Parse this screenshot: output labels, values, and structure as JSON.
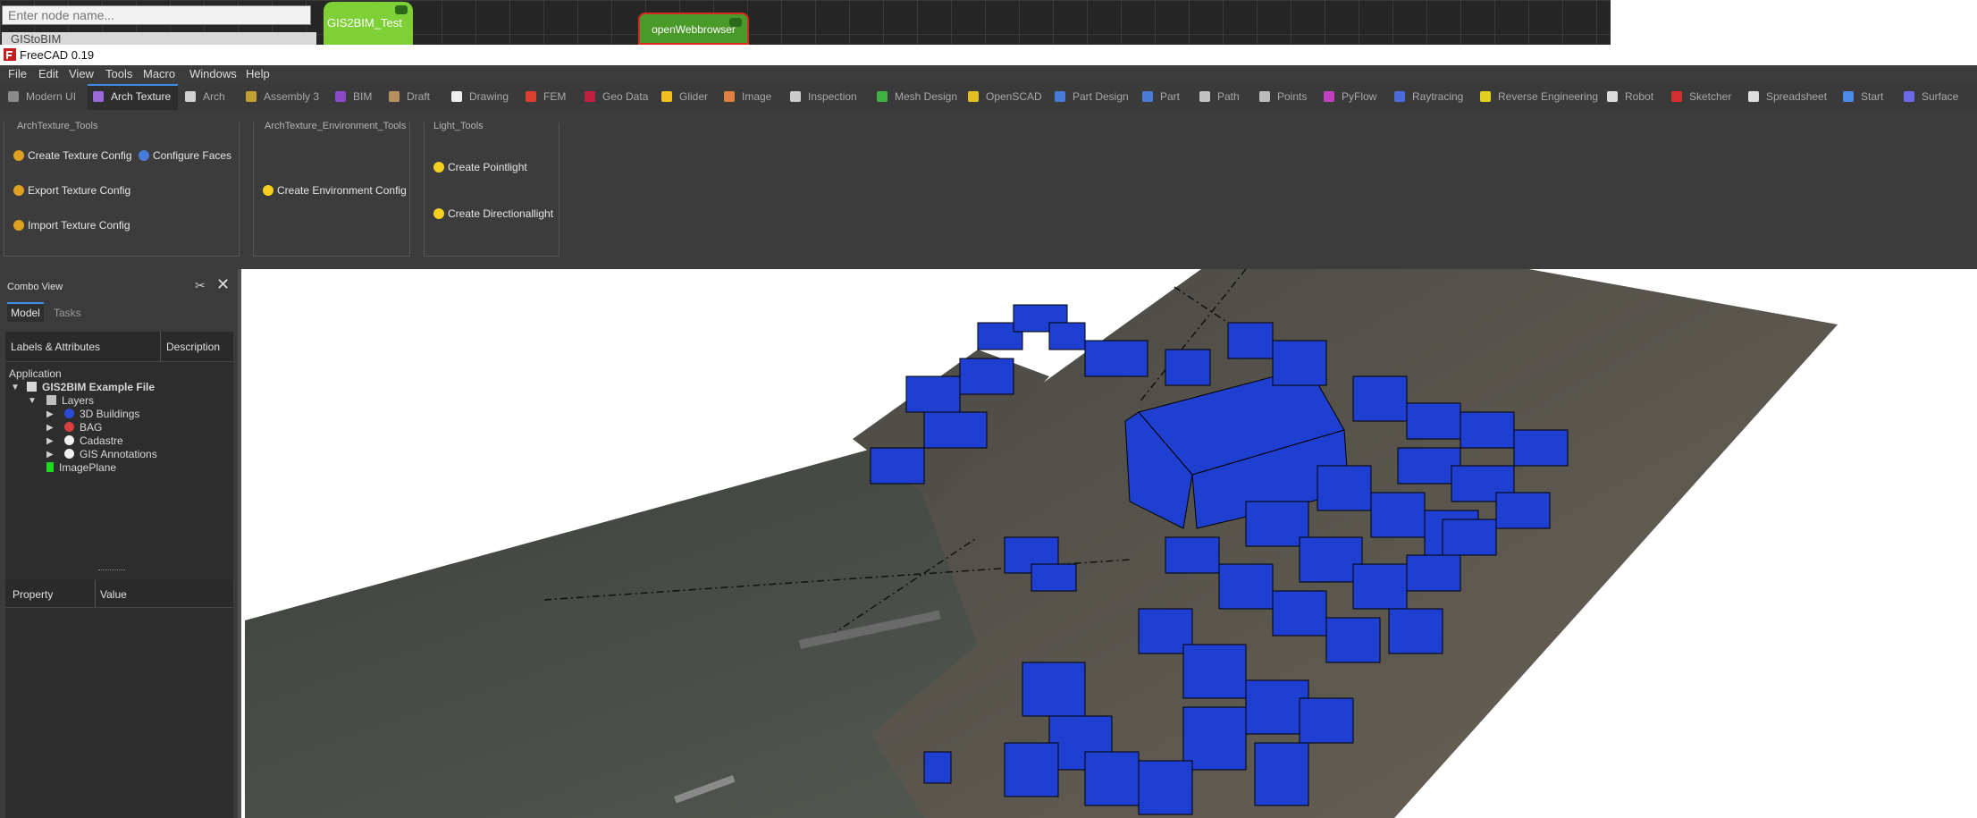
{
  "node_editor": {
    "search_placeholder": "Enter node name...",
    "list_item": "GIStoBIM",
    "node_gis2bim": "GIS2BIM_Test",
    "node_browser": "openWebbrowser"
  },
  "window": {
    "title": "FreeCAD 0.19"
  },
  "menu": [
    "File",
    "Edit",
    "View",
    "Tools",
    "Macro",
    "Windows",
    "Help"
  ],
  "workbenches": [
    {
      "label": "Modern UI",
      "color": "#8a8a8a"
    },
    {
      "label": "Arch Texture",
      "color": "#9a6ad8",
      "active": true
    },
    {
      "label": "Arch",
      "color": "#d0d0d0"
    },
    {
      "label": "Assembly 3",
      "color": "#c0a030"
    },
    {
      "label": "BIM",
      "color": "#8a4ac8"
    },
    {
      "label": "Draft",
      "color": "#b89060"
    },
    {
      "label": "Drawing",
      "color": "#eeeeee"
    },
    {
      "label": "FEM",
      "color": "#d84030"
    },
    {
      "label": "Geo Data",
      "color": "#c02040"
    },
    {
      "label": "Glider",
      "color": "#f0c020"
    },
    {
      "label": "Image",
      "color": "#e08040"
    },
    {
      "label": "Inspection",
      "color": "#cccccc"
    },
    {
      "label": "Mesh Design",
      "color": "#40b040"
    },
    {
      "label": "OpenSCAD",
      "color": "#e0c020"
    },
    {
      "label": "Part Design",
      "color": "#4a7ad8"
    },
    {
      "label": "Part",
      "color": "#4a7ad8"
    },
    {
      "label": "Path",
      "color": "#c0c0c0"
    },
    {
      "label": "Points",
      "color": "#bbbbbb"
    },
    {
      "label": "PyFlow",
      "color": "#c040c0"
    },
    {
      "label": "Raytracing",
      "color": "#4a6ad8"
    },
    {
      "label": "Reverse Engineering",
      "color": "#e0d020"
    },
    {
      "label": "Robot",
      "color": "#dddddd"
    },
    {
      "label": "Sketcher",
      "color": "#d03030"
    },
    {
      "label": "Spreadsheet",
      "color": "#dddddd"
    },
    {
      "label": "Start",
      "color": "#4a8ae8"
    },
    {
      "label": "Surface",
      "color": "#6a6ae8"
    }
  ],
  "ribbon": {
    "groups": [
      {
        "title": "ArchTexture_Tools",
        "tools": [
          "Create Texture Config",
          "Configure Faces",
          "Export Texture Config",
          "Import Texture Config"
        ]
      },
      {
        "title": "ArchTexture_Environment_Tools",
        "tools": [
          "Create Environment Config"
        ]
      },
      {
        "title": "Light_Tools",
        "tools": [
          "Create Pointlight",
          "Create Directionallight"
        ]
      }
    ]
  },
  "combo_view": {
    "title": "Combo View",
    "tabs": [
      "Model",
      "Tasks"
    ],
    "tree_headers": [
      "Labels & Attributes",
      "Description"
    ],
    "tree": {
      "section": "Application",
      "root": "GIS2BIM Example File",
      "layers": "Layers",
      "children": [
        "3D Buildings",
        "BAG",
        "Cadastre",
        "GIS Annotations"
      ],
      "image_plane": "ImagePlane"
    },
    "property_headers": [
      "Property",
      "Value"
    ]
  }
}
